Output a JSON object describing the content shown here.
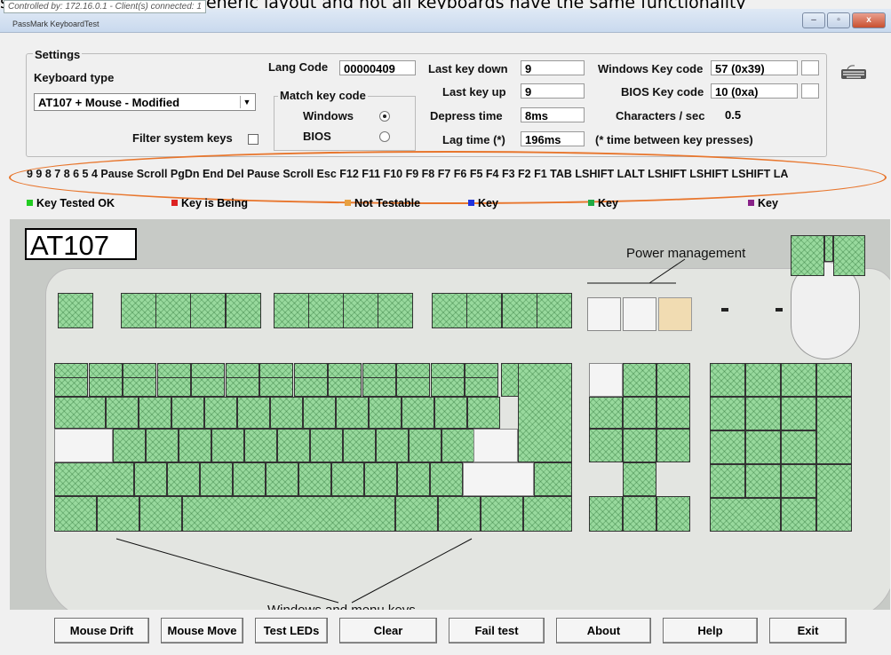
{
  "banner": "s keyboard test uses a generic layout and not all keyboards have the same functionality",
  "controlled_by": "Controlled by: 172.16.0.1 - Client(s) connected: 1",
  "app_title": "PassMark KeyboardTest",
  "window_buttons": {
    "minimize": "–",
    "maximize": "▫",
    "close": "x"
  },
  "settings": {
    "title": "Settings",
    "keyboard_type_label": "Keyboard type",
    "keyboard_type_value": "AT107 + Mouse - Modified",
    "filter_label": "Filter system keys",
    "lang_code_label": "Lang Code",
    "lang_code_value": "00000409",
    "match_label": "Match key code",
    "windows_label": "Windows",
    "bios_label": "BIOS",
    "last_down_label": "Last key down",
    "last_down_value": "9",
    "last_up_label": "Last key up",
    "last_up_value": "9",
    "depress_label": "Depress time",
    "depress_value": "8ms",
    "lag_label": "Lag time (*)",
    "lag_value": "196ms",
    "win_code_label": "Windows Key code",
    "win_code_value": "57 (0x39)",
    "bios_code_label": "BIOS Key code",
    "bios_code_value": "10 (0xa)",
    "cps_label": "Characters / sec",
    "cps_value": "0.5",
    "lag_note": "(* time between key presses)"
  },
  "key_log": "9 9 8 7 8 6 5 4 Pause Scroll PgDn End Del Pause Scroll Esc F12 F11 F10 F9 F8 F7 F6 F5 F4 F3 F2 F1 TAB LSHIFT LALT LSHIFT LSHIFT LSHIFT LA",
  "legend": [
    {
      "label": "Key Tested OK",
      "color": "#22cc22"
    },
    {
      "label": "Key is Being",
      "color": "#dd2222"
    },
    {
      "label": "Not Testable",
      "color": "#e8a040"
    },
    {
      "label": "Key",
      "color": "#2233dd"
    },
    {
      "label": "Key",
      "color": "#22aa44"
    },
    {
      "label": "Key",
      "color": "#882288"
    }
  ],
  "keyboard_model": "AT107",
  "power_label": "Power management",
  "windows_keys_label": "Windows and menu keys",
  "buttons": [
    "Mouse Drift",
    "Mouse Move",
    "Test LEDs",
    "Clear",
    "Fail test",
    "About",
    "Help",
    "Exit"
  ]
}
